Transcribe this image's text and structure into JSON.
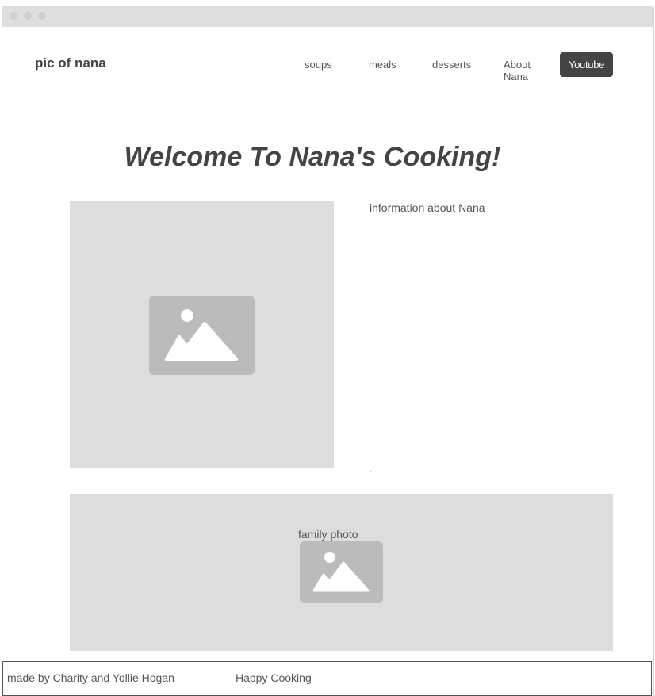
{
  "header": {
    "logo": "pic of nana",
    "nav": [
      "soups",
      "meals",
      "desserts",
      "About Nana"
    ],
    "cta": "Youtube"
  },
  "main": {
    "headline": "Welcome To Nana's Cooking!",
    "info": "information about Nana",
    "info_end": ".",
    "family_photo_label": "family photo"
  },
  "footer": {
    "credit": "made by Charity and Yollie Hogan",
    "tagline": "Happy Cooking"
  },
  "icons": {
    "window_controls": [
      "window-dot-icon",
      "window-dot-icon",
      "window-dot-icon"
    ],
    "placeholder": "image-placeholder-icon"
  },
  "colors": {
    "accent": "#444444",
    "placeholder_bg": "#dddddd",
    "placeholder_icon": "#bbbbbb"
  }
}
